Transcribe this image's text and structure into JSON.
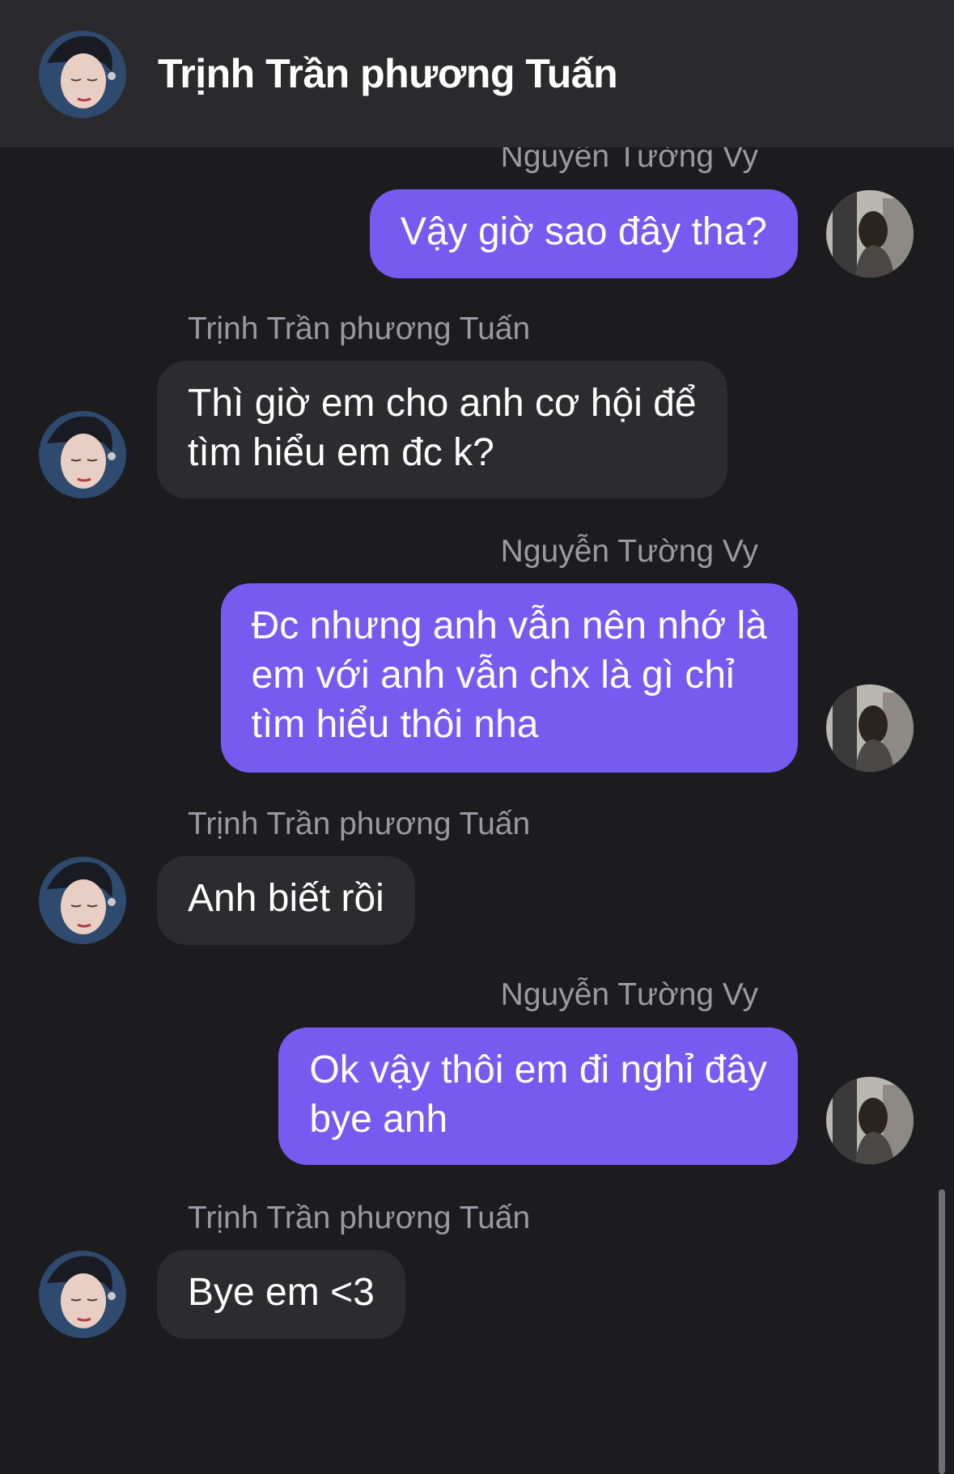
{
  "header": {
    "title": "Trịnh Trần phương Tuấn",
    "avatar_icon": "contact-avatar-icon"
  },
  "messages": [
    {
      "from": "me",
      "sender": "Nguyễn Tường Vy",
      "lines": [
        "Vậy giờ sao đây tha?"
      ]
    },
    {
      "from": "them",
      "sender": "Trịnh Trần phương Tuấn",
      "lines": [
        "Thì giờ em cho anh cơ hội để",
        "tìm hiểu em đc k?"
      ]
    },
    {
      "from": "me",
      "sender": "Nguyễn Tường Vy",
      "lines": [
        "Đc nhưng anh vẫn nên nhớ là",
        "em với anh vẫn chx là gì chỉ",
        "tìm hiểu thôi nha"
      ]
    },
    {
      "from": "them",
      "sender": "Trịnh Trần phương Tuấn",
      "lines": [
        "Anh biết rồi"
      ]
    },
    {
      "from": "me",
      "sender": "Nguyễn Tường Vy",
      "lines": [
        "Ok vậy thôi em đi nghỉ đây",
        "bye anh"
      ]
    },
    {
      "from": "them",
      "sender": "Trịnh Trần phương Tuấn",
      "lines": [
        "Bye em <3"
      ]
    }
  ],
  "colors": {
    "background": "#1c1c1e",
    "header": "#2a2a2c",
    "my_bubble": "#755bf0",
    "their_bubble": "#2c2c2f",
    "sender_label": "#9a9aa0"
  }
}
